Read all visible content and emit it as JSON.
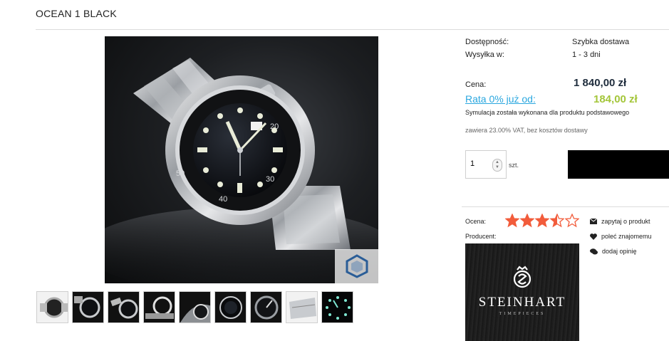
{
  "product": {
    "title": "OCEAN 1 BLACK"
  },
  "availability": {
    "label": "Dostępność:",
    "value": "Szybka dostawa",
    "shipping_label": "Wysyłka w:",
    "shipping_value": "1 - 3 dni"
  },
  "price": {
    "label": "Cena:",
    "value": "1 840,00 zł",
    "installment_link": "Rata 0% już od:",
    "installment_value": "184,00 zł",
    "installment_note": "Symulacja została wykonana dla produktu podstawowego",
    "vat_note": "zawiera 23.00% VAT, bez kosztów dostawy"
  },
  "cart": {
    "quantity": "1",
    "unit": "szt.",
    "button_color": "#000000"
  },
  "rating": {
    "label": "Ocena:",
    "stars_total": 5,
    "stars_value": 3.5,
    "star_color": "#f25c3b"
  },
  "producer": {
    "label": "Producent:",
    "brand": "STEINHART",
    "brand_sub": "TIMEPIECES"
  },
  "actions": {
    "ask": {
      "label": "zapytaj o produkt",
      "icon": "envelope-icon"
    },
    "recommend": {
      "label": "poleć znajomemu",
      "icon": "heart-icon"
    },
    "review": {
      "label": "dodaj opinię",
      "icon": "speech-bubbles-icon"
    }
  },
  "gallery": {
    "thumbnail_count": 9,
    "zoom_icon": "cube-zoom-icon"
  },
  "colors": {
    "accent_link": "#2aa7df",
    "installment_green": "#a4c63a",
    "price_navy": "#1f2d3d"
  }
}
